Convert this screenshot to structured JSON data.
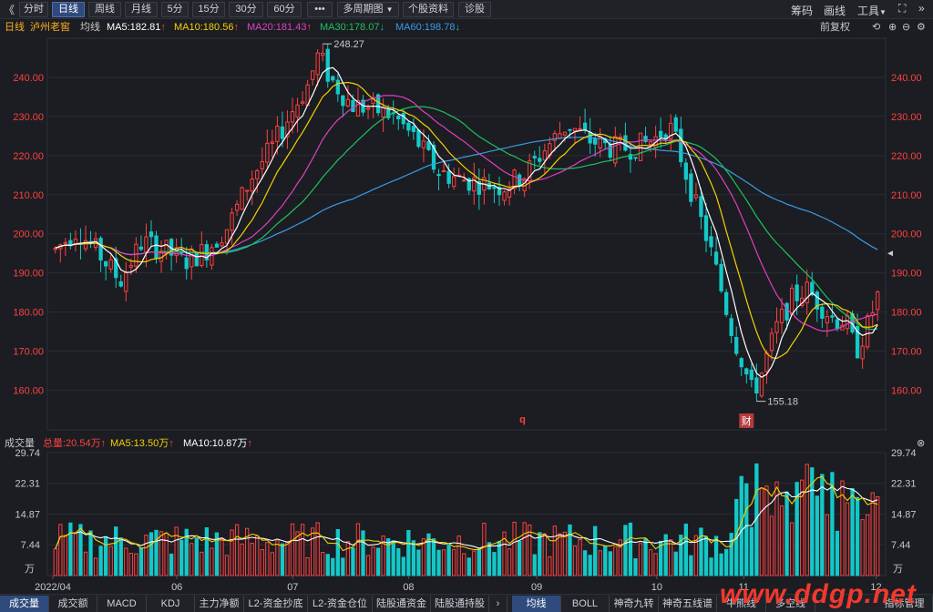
{
  "toolbar": {
    "back_glyph": "《",
    "timeframes": [
      {
        "label": "分时"
      },
      {
        "label": "日线"
      },
      {
        "label": "周线"
      },
      {
        "label": "月线"
      },
      {
        "label": "5分"
      },
      {
        "label": "15分"
      },
      {
        "label": "30分"
      },
      {
        "label": "60分"
      }
    ],
    "more_label": "•••",
    "multi_period_label": "多周期图",
    "profile_label": "个股资料",
    "diagnose_label": "诊股",
    "chips_label": "筹码",
    "draw_label": "画线",
    "tools_label": "工具"
  },
  "indicator_bar": {
    "period": "日线",
    "stock_name": "泸州老窖",
    "ma_title": "均线",
    "ma5": "MA5:182.81",
    "ma10": "MA10:180.56",
    "ma20": "MA20:181.43",
    "ma30": "MA30:178.07",
    "ma60": "MA60:198.78",
    "adjust_label": "前复权"
  },
  "colors": {
    "up": "#ff4040",
    "down": "#14c8c8",
    "ma5": "#ffffff",
    "ma10": "#f5d000",
    "ma20": "#e040c0",
    "ma30": "#20c060",
    "ma60": "#3a9ae8"
  },
  "chart_data": {
    "type": "candlestick",
    "y_ticks": [
      "240.00",
      "230.00",
      "220.00",
      "210.00",
      "200.00",
      "190.00",
      "180.00",
      "170.00",
      "160.00"
    ],
    "ylim": [
      155,
      250
    ],
    "high_label": "248.27",
    "low_label": "155.18",
    "x_labels": [
      "2022/04",
      "06",
      "07",
      "08",
      "09",
      "10",
      "11",
      "12"
    ],
    "markers": {
      "q": "q",
      "fin": "财"
    },
    "volume": {
      "title": "成交量",
      "total": "总量:20.54万",
      "ma5": "MA5:13.50万",
      "ma10": "MA10:10.87万",
      "y_ticks": [
        "29.74",
        "22.31",
        "14.87",
        "7.44"
      ],
      "unit": "万",
      "ylim": [
        0,
        29.74
      ]
    }
  },
  "bottom_tabs": {
    "left": [
      "成交量",
      "成交额",
      "MACD",
      "KDJ",
      "主力净额",
      "L2-资金抄底",
      "L2-资金仓位",
      "陆股通资金",
      "陆股通持股"
    ],
    "right": [
      "均线",
      "BOLL",
      "神奇九转",
      "神奇五线谱",
      "牛熊线",
      "多空线",
      "指标管理"
    ]
  },
  "watermark": "www.ddgp.net"
}
